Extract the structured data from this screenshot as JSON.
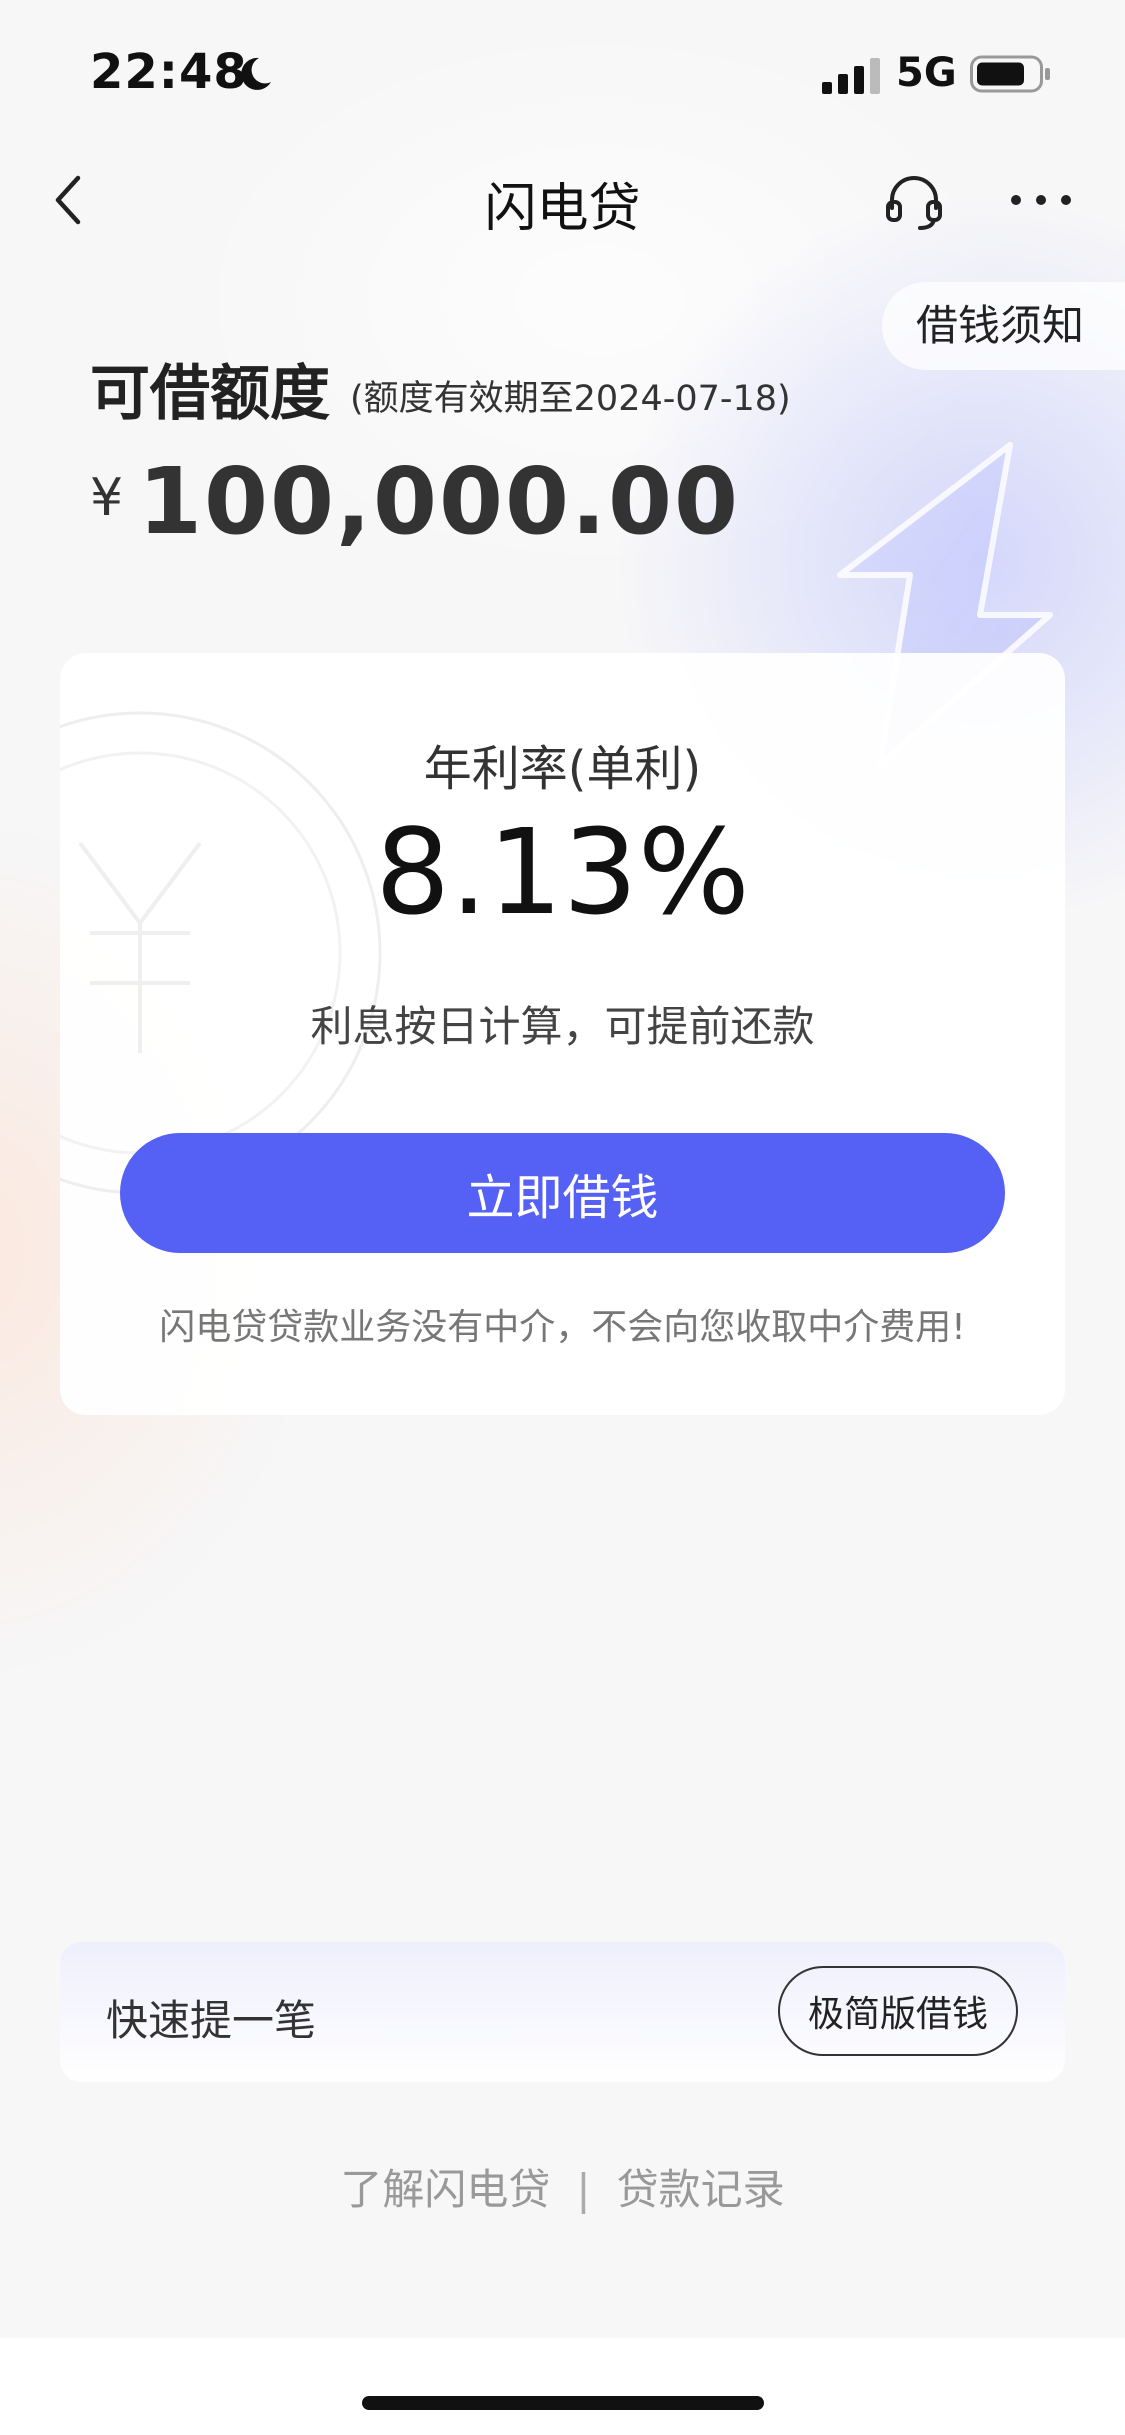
{
  "status_bar": {
    "time": "22:48",
    "network": "5G",
    "icons": [
      "moon-icon",
      "cellular-signal-icon",
      "battery-icon"
    ]
  },
  "nav": {
    "title": "闪电贷",
    "icons": [
      "back-chevron-icon",
      "headset-icon",
      "more-dots-icon"
    ]
  },
  "notice_pill": "借钱须知",
  "limit": {
    "label": "可借额度",
    "expiry": "(额度有效期至2024-07-18)",
    "currency": "¥",
    "amount": "100,000.00"
  },
  "rate_card": {
    "label": "年利率(单利)",
    "value": "8.13%",
    "note": "利息按日计算，可提前还款",
    "button": "立即借钱",
    "footer": "闪电贷贷款业务没有中介，不会向您收取中介费用!"
  },
  "quick": {
    "label": "快速提一笔",
    "button": "极简版借钱"
  },
  "links": {
    "about": "了解闪电贷",
    "separator": "|",
    "records": "贷款记录"
  },
  "colors": {
    "accent": "#5561f5",
    "background": "#f7f7f8"
  }
}
